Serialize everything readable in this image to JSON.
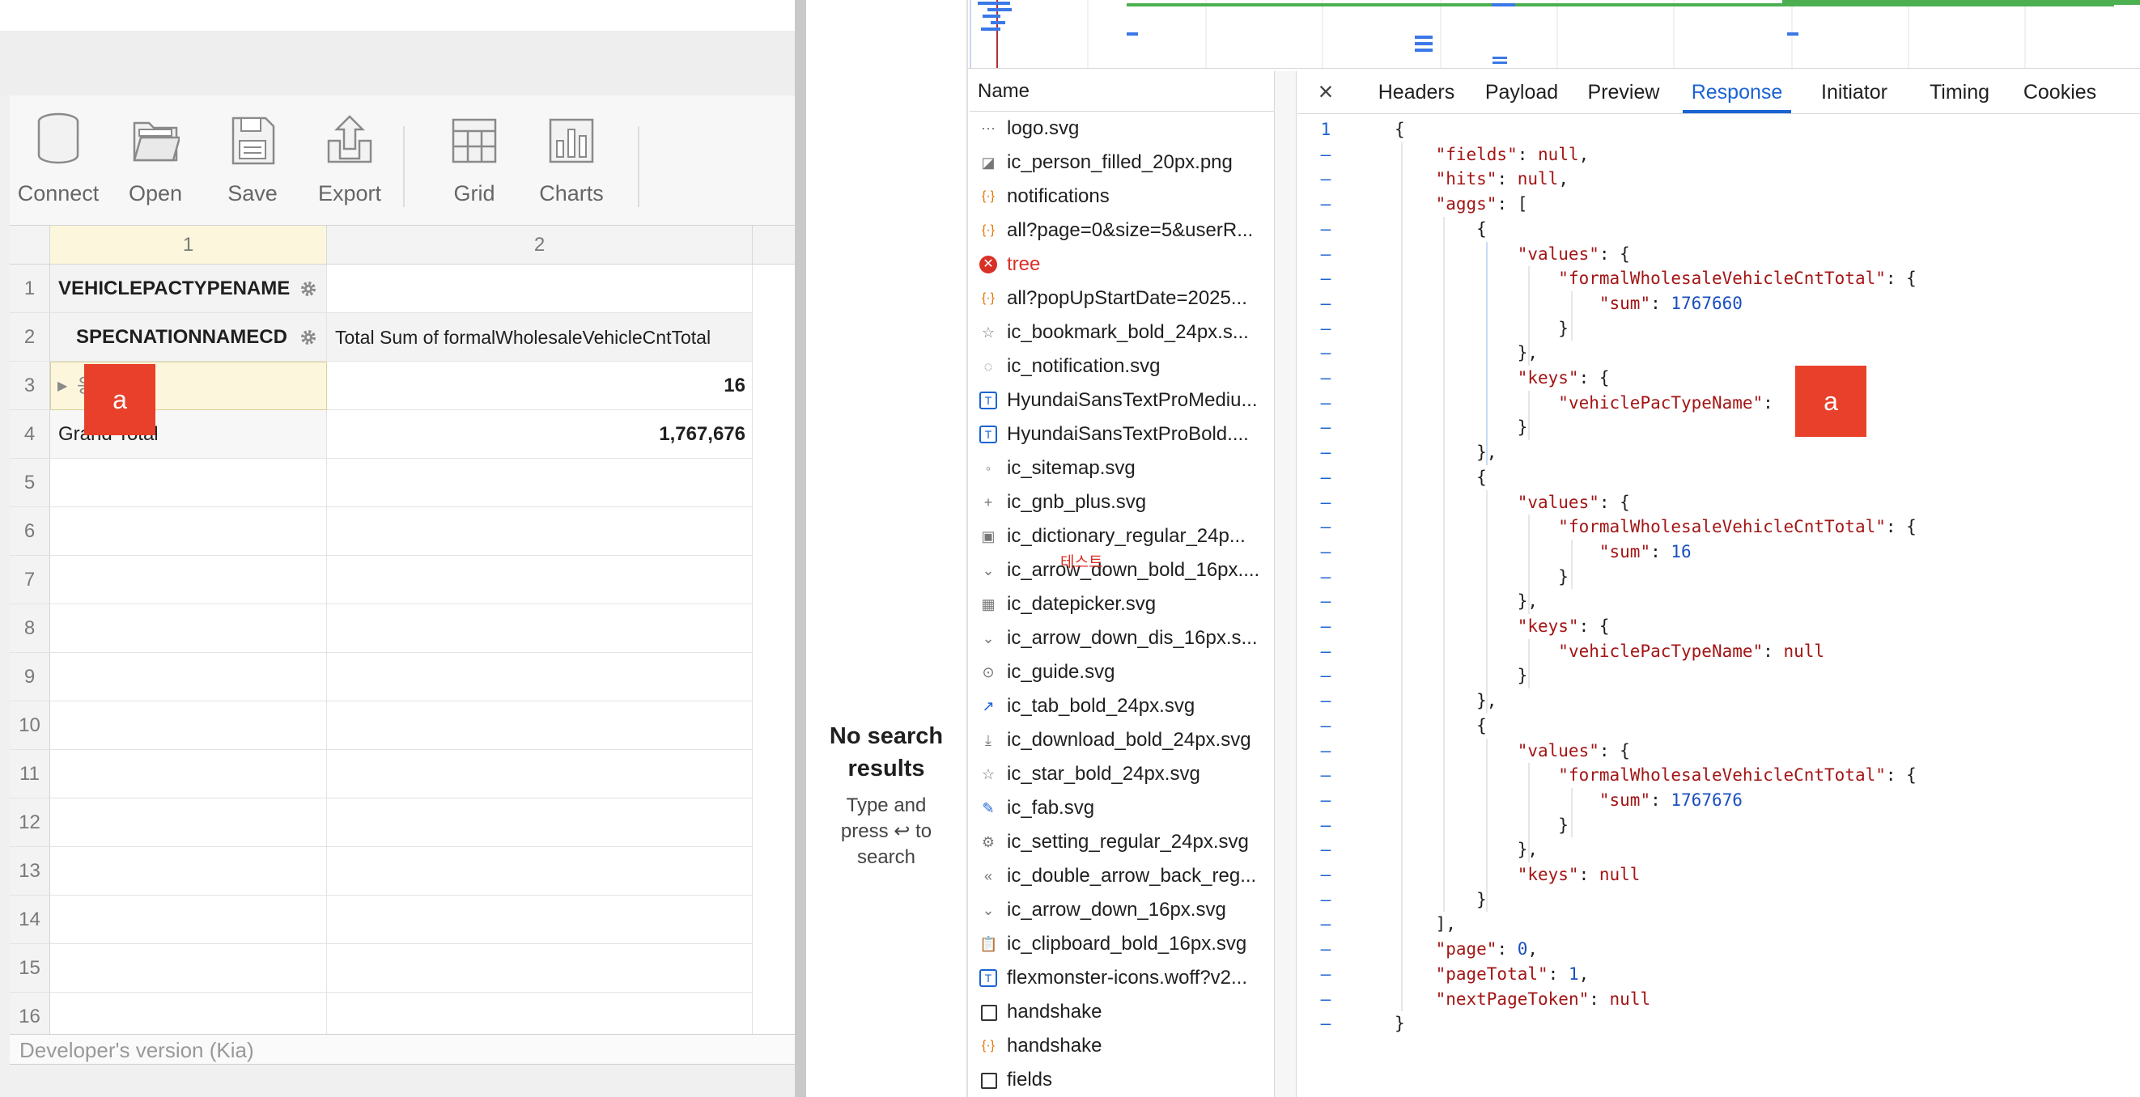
{
  "toolbar": {
    "buttons": [
      {
        "label": "Connect",
        "icon": "database-icon"
      },
      {
        "label": "Open",
        "icon": "folder-icon"
      },
      {
        "label": "Save",
        "icon": "save-icon"
      },
      {
        "label": "Export",
        "icon": "export-icon"
      },
      {
        "label": "Grid",
        "icon": "grid-icon"
      },
      {
        "label": "Charts",
        "icon": "charts-icon"
      }
    ]
  },
  "grid": {
    "columns": [
      "1",
      "2"
    ],
    "row_numbers": [
      "1",
      "2",
      "3",
      "4",
      "5",
      "6",
      "7",
      "8",
      "9",
      "10",
      "11",
      "12",
      "13",
      "14",
      "15",
      "16"
    ],
    "row1_field": "VEHICLEPACTYPENAME",
    "row2_field": "SPECNATIONNAMECD",
    "row2_measure": "Total Sum of formalWholesaleVehicleCntTotal",
    "row3_label": "응",
    "row3_value": "16",
    "row4_label": "Grand Total",
    "row4_value": "1,767,676",
    "footer": "Developer's version (Kia)"
  },
  "redaction_labels": {
    "left": "a",
    "right": "a"
  },
  "overlay_text": "테스트",
  "search": {
    "no_results": "No search results",
    "hint": "Type and press ↩ to search"
  },
  "network": {
    "name_header": "Name",
    "requests": [
      {
        "name": "logo.svg",
        "icon": "svg-dots-icon"
      },
      {
        "name": "ic_person_filled_20px.png",
        "icon": "image-icon"
      },
      {
        "name": "notifications",
        "icon": "fetch-icon"
      },
      {
        "name": "all?page=0&size=5&userR...",
        "icon": "fetch-icon"
      },
      {
        "name": "tree",
        "icon": "error-icon",
        "error": true
      },
      {
        "name": "all?popUpStartDate=2025...",
        "icon": "fetch-icon"
      },
      {
        "name": "ic_bookmark_bold_24px.s...",
        "icon": "svg-icon"
      },
      {
        "name": "ic_notification.svg",
        "icon": "svg-icon"
      },
      {
        "name": "HyundaiSansTextProMediu...",
        "icon": "font-icon"
      },
      {
        "name": "HyundaiSansTextProBold....",
        "icon": "font-icon"
      },
      {
        "name": "ic_sitemap.svg",
        "icon": "svg-icon"
      },
      {
        "name": "ic_gnb_plus.svg",
        "icon": "plus-icon"
      },
      {
        "name": "ic_dictionary_regular_24p...",
        "icon": "svg-icon"
      },
      {
        "name": "ic_arrow_down_bold_16px....",
        "icon": "chevron-down-icon"
      },
      {
        "name": "ic_datepicker.svg",
        "icon": "calendar-icon"
      },
      {
        "name": "ic_arrow_down_dis_16px.s...",
        "icon": "chevron-down-icon"
      },
      {
        "name": "ic_guide.svg",
        "icon": "svg-icon"
      },
      {
        "name": "ic_tab_bold_24px.svg",
        "icon": "external-link-icon"
      },
      {
        "name": "ic_download_bold_24px.svg",
        "icon": "download-icon"
      },
      {
        "name": "ic_star_bold_24px.svg",
        "icon": "star-icon"
      },
      {
        "name": "ic_fab.svg",
        "icon": "svg-icon"
      },
      {
        "name": "ic_setting_regular_24px.svg",
        "icon": "gear-icon"
      },
      {
        "name": "ic_double_arrow_back_reg...",
        "icon": "double-chevron-icon"
      },
      {
        "name": "ic_arrow_down_16px.svg",
        "icon": "chevron-down-icon"
      },
      {
        "name": "ic_clipboard_bold_16px.svg",
        "icon": "clipboard-icon"
      },
      {
        "name": "flexmonster-icons.woff?v2...",
        "icon": "font-icon"
      },
      {
        "name": "handshake",
        "icon": "document-icon"
      },
      {
        "name": "handshake",
        "icon": "fetch-icon"
      },
      {
        "name": "fields",
        "icon": "document-icon"
      }
    ]
  },
  "detail": {
    "close_icon": "close-icon",
    "tabs": [
      "Headers",
      "Payload",
      "Preview",
      "Response",
      "Initiator",
      "Timing",
      "Cookies"
    ],
    "active_tab": "Response"
  },
  "response": {
    "first_line_number": "1",
    "line_marker": "–",
    "lines": [
      "{",
      "    \"fields\": null,",
      "    \"hits\": null,",
      "    \"aggs\": [",
      "        {",
      "            \"values\": {",
      "                \"formalWholesaleVehicleCntTotal\": {",
      "                    \"sum\": 1767660",
      "                }",
      "            },",
      "            \"keys\": {",
      "                \"vehiclePacTypeName\": ",
      "            }",
      "        },",
      "        {",
      "            \"values\": {",
      "                \"formalWholesaleVehicleCntTotal\": {",
      "                    \"sum\": 16",
      "                }",
      "            },",
      "            \"keys\": {",
      "                \"vehiclePacTypeName\": null",
      "            }",
      "        },",
      "        {",
      "            \"values\": {",
      "                \"formalWholesaleVehicleCntTotal\": {",
      "                    \"sum\": 1767676",
      "                }",
      "            },",
      "            \"keys\": null",
      "        }",
      "    ],",
      "    \"page\": 0,",
      "    \"pageTotal\": 1,",
      "    \"nextPageToken\": null",
      "}"
    ]
  },
  "colors": {
    "accent_blue": "#1a63d3",
    "json_key": "#a31515",
    "json_number": "#1a4fbf",
    "redaction": "#e8402a",
    "error": "#d93025",
    "timeline_green": "#4caf50"
  }
}
